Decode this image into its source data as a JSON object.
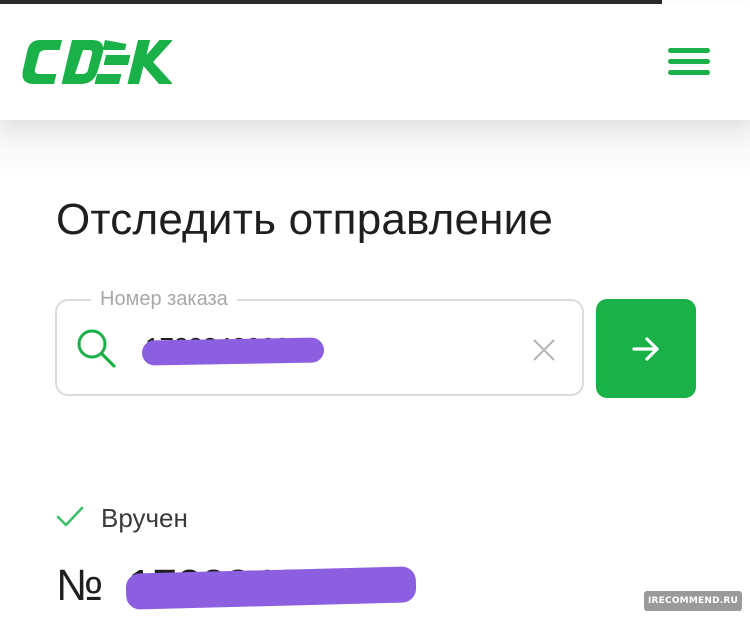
{
  "top_right_tag": "summer_166",
  "brand": {
    "logo_text": "CDEK",
    "accent_color": "#1ab248"
  },
  "header": {
    "menu_icon": "hamburger-menu-icon"
  },
  "tracking": {
    "title": "Отследить отправление",
    "order_field": {
      "label": "Номер заказа",
      "value": "1723348062",
      "search_icon": "search-icon",
      "clear_icon": "close-icon"
    },
    "submit_icon": "arrow-right-icon"
  },
  "result": {
    "status_icon": "check-icon",
    "status_text": "Вручен",
    "number_prefix": "№",
    "number_value": "1723348062"
  },
  "redaction_color": "#8b5fe0",
  "watermark": "IRECOMMEND.RU"
}
